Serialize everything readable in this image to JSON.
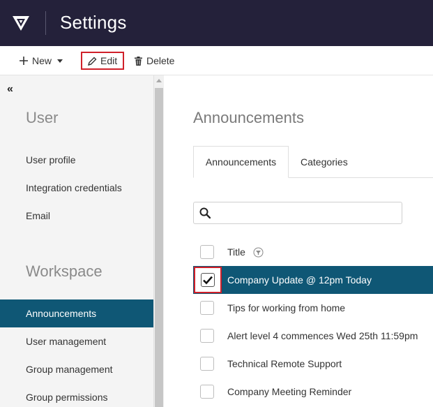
{
  "header": {
    "title": "Settings"
  },
  "toolbar": {
    "new_label": "New",
    "edit_label": "Edit",
    "delete_label": "Delete"
  },
  "sidebar": {
    "collapse_label": "«",
    "user_section": "User",
    "user_items": [
      "User profile",
      "Integration credentials",
      "Email"
    ],
    "workspace_section": "Workspace",
    "workspace_items": [
      "Announcements",
      "User management",
      "Group management",
      "Group permissions"
    ],
    "active_item": "Announcements"
  },
  "main": {
    "title": "Announcements",
    "tabs": [
      {
        "label": "Announcements",
        "active": true
      },
      {
        "label": "Categories",
        "active": false
      }
    ],
    "search": {
      "placeholder": "",
      "value": ""
    },
    "list": {
      "column_title": "Title",
      "rows": [
        {
          "title": "Company Update @ 12pm Today",
          "checked": true,
          "selected": true
        },
        {
          "title": "Tips for working from home",
          "checked": false,
          "selected": false
        },
        {
          "title": "Alert level 4 commences Wed 25th 11:59pm",
          "checked": false,
          "selected": false
        },
        {
          "title": "Technical Remote Support",
          "checked": false,
          "selected": false
        },
        {
          "title": "Company Meeting Reminder",
          "checked": false,
          "selected": false
        }
      ]
    }
  },
  "colors": {
    "header_bg": "#24213a",
    "accent": "#0f5775",
    "highlight_border": "#d0202a",
    "sidebar_bg": "#f4f4f4"
  },
  "icons": [
    "logo-icon",
    "plus-icon",
    "caret-down-icon",
    "pencil-icon",
    "trash-icon",
    "collapse-icon",
    "search-icon",
    "filter-icon",
    "checkmark-icon"
  ]
}
